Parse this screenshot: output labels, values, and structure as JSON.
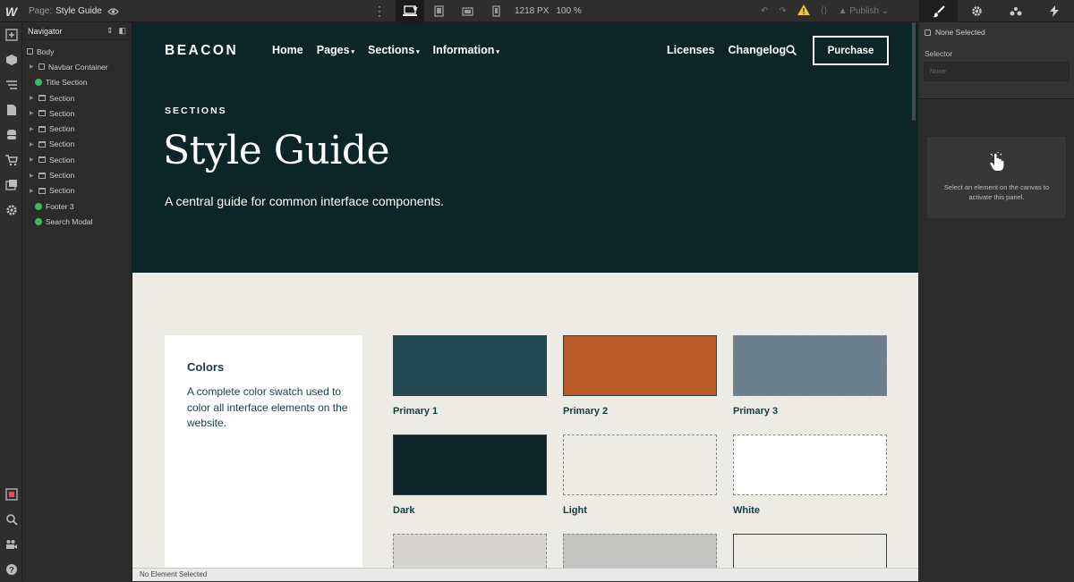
{
  "topbar": {
    "logo": "W",
    "page_label": "Page:",
    "page_name": "Style Guide",
    "width_readout": "1218 PX",
    "zoom": "100 %",
    "publish_label": "Publish"
  },
  "navigator": {
    "title": "Navigator",
    "items": [
      {
        "label": "Body"
      },
      {
        "label": "Navbar Container"
      },
      {
        "label": "Title Section"
      },
      {
        "label": "Section"
      },
      {
        "label": "Section"
      },
      {
        "label": "Section"
      },
      {
        "label": "Section"
      },
      {
        "label": "Section"
      },
      {
        "label": "Section"
      },
      {
        "label": "Section"
      },
      {
        "label": "Footer 3"
      },
      {
        "label": "Search Modal"
      }
    ]
  },
  "site": {
    "brand": "BEACON",
    "nav_left": [
      "Home",
      "Pages",
      "Sections",
      "Information"
    ],
    "nav_right": [
      "Licenses",
      "Changelog"
    ],
    "purchase": "Purchase",
    "eyebrow": "SECTIONS",
    "title": "Style Guide",
    "subtitle": "A central guide for common interface components.",
    "colors_card": {
      "heading": "Colors",
      "text": "A complete color swatch used to color all interface elements on the website."
    },
    "swatches": [
      {
        "label": "Primary 1",
        "color": "#234a52"
      },
      {
        "label": "Primary 2",
        "color": "#b95a28"
      },
      {
        "label": "Primary 3",
        "color": "#6b7f8d"
      },
      {
        "label": "Dark",
        "color": "#0c2529"
      },
      {
        "label": "Light",
        "color": "#edebe6"
      },
      {
        "label": "White",
        "color": "#ffffff"
      },
      {
        "label": "",
        "color": "#d5d4d1"
      },
      {
        "label": "",
        "color": "#c3c4c1"
      },
      {
        "label": "",
        "color": "#edebe6"
      }
    ]
  },
  "status": {
    "text": "No Element Selected"
  },
  "right_panel": {
    "none_selected": "None Selected",
    "selector_label": "Selector",
    "selector_placeholder": "None",
    "empty_msg": "Select an element on the canvas to activate this panel."
  }
}
